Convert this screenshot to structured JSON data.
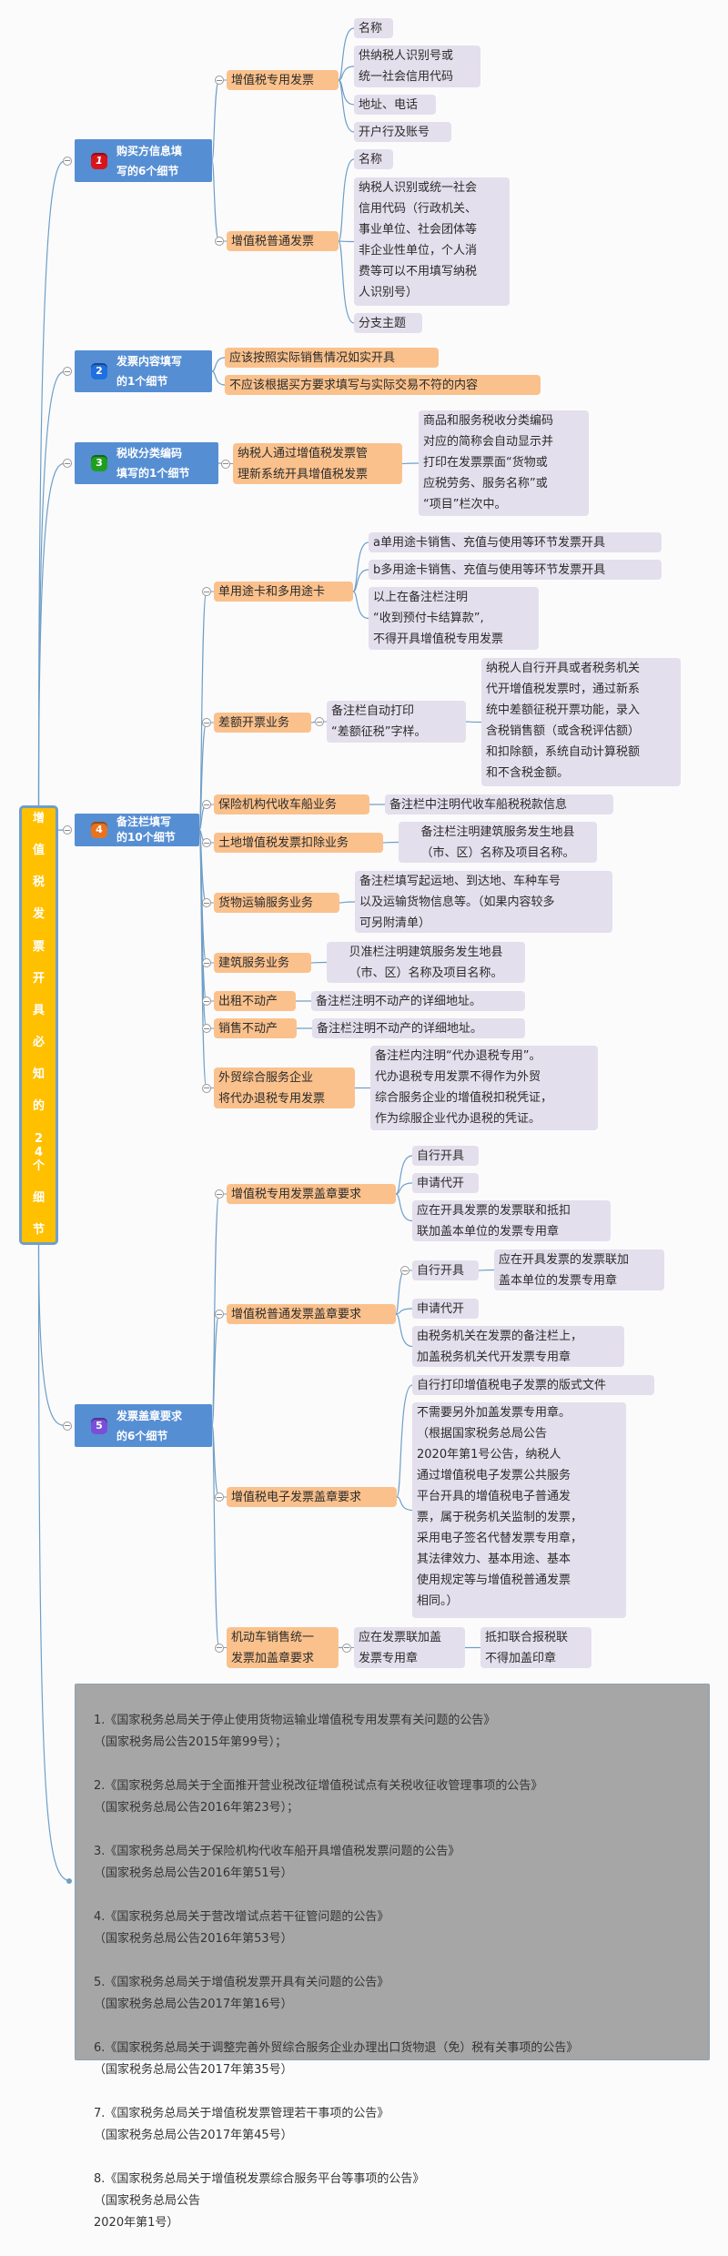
{
  "root": {
    "label": "增值税发票开具必知的24个细节",
    "chars": [
      "增",
      "值",
      "税",
      "发",
      "票",
      "开",
      "具",
      "必",
      "知",
      "的",
      "24个",
      "细",
      "节"
    ]
  },
  "colors": {
    "root": "#ffc000",
    "category": "#568ed3",
    "branch": "#fbc18c",
    "leaf": "#e4dfec",
    "line": "#6f9fc7",
    "refs": "#a6a6a6"
  },
  "categories": [
    {
      "num": "1",
      "badge_color": "#d9141a",
      "label": "购买方信息填\n写的6个细节"
    },
    {
      "num": "2",
      "badge_color": "#1f6fe0",
      "label": "发票内容填写\n的1个细节"
    },
    {
      "num": "3",
      "badge_color": "#1f9e1f",
      "label": "税收分类编码\n填写的1个细节"
    },
    {
      "num": "4",
      "badge_color": "#e8731f",
      "label": "备注栏填写\n的10个细节"
    },
    {
      "num": "5",
      "badge_color": "#7a4fd8",
      "label": "发票盖章要求\n的6个细节"
    }
  ],
  "c1": {
    "special": {
      "label": "增值税专用发票",
      "items": [
        "名称",
        "供纳税人识别号或\n统一社会信用代码",
        "地址、电话",
        "开户行及账号"
      ]
    },
    "normal": {
      "label": "增值税普通发票",
      "items": [
        "名称",
        "纳税人识别或统一社会\n信用代码（行政机关、\n事业单位、社会团体等\n非企业性单位，个人消\n费等可以不用填写纳税\n人识别号）",
        "分支主题"
      ]
    }
  },
  "c2": {
    "items": [
      "应该按照实际销售情况如实开具",
      "不应该根据买方要求填写与实际交易不符的内容"
    ]
  },
  "c3": {
    "label": "纳税人通过增值税发票管\n理新系统开具增值税发票",
    "detail": "商品和服务税收分类编码\n对应的简称会自动显示并\n打印在发票票面“货物或\n应税劳务、服务名称”或\n“项目”栏次中。"
  },
  "c4": {
    "card": {
      "label": "单用途卡和多用途卡",
      "items": [
        "a单用途卡销售、充值与使用等环节发票开具",
        "b多用途卡销售、充值与使用等环节发票开具",
        "以上在备注栏注明\n“收到预付卡结算款”,\n不得开具增值税专用发票"
      ]
    },
    "diff": {
      "label": "差额开票业务",
      "note": "备注栏自动打印\n“差额征税”字样。",
      "detail": "纳税人自行开具或者税务机关\n代开增值税发票时，通过新系\n统中差额征税开票功能，录入\n含税销售额（或含税评估额）\n和扣除额，系统自动计算税额\n和不含税金额。"
    },
    "insurance": {
      "label": "保险机构代收车船业务",
      "note": "备注栏中注明代收车船税税款信息"
    },
    "land": {
      "label": "土地增值税发票扣除业务",
      "note": "备注栏注明建筑服务发生地县\n（市、区）名称及项目名称。"
    },
    "freight": {
      "label": "货物运输服务业务",
      "note": "备注栏填写起运地、到达地、车种车号\n以及运输货物信息等。（如果内容较多\n可另附清单）"
    },
    "construction": {
      "label": "建筑服务业务",
      "note": "贝准栏注明建筑服务发生地县\n（市、区）名称及项目名称。"
    },
    "rent": {
      "label": "出租不动产",
      "note": "备注栏注明不动产的详细地址。"
    },
    "sale": {
      "label": "销售不动产",
      "note": "备注栏注明不动产的详细地址。"
    },
    "trade": {
      "label": "外贸综合服务企业\n将代办退税专用发票",
      "note": "备注栏内注明“代办退税专用”。\n代办退税专用发票不得作为外贸\n综合服务企业的增值税扣税凭证，\n作为综服企业代办退税的凭证。"
    }
  },
  "c5": {
    "special": {
      "label": "增值税专用发票盖章要求",
      "items": [
        "自行开具",
        "申请代开",
        "应在开具发票的发票联和抵扣\n联加盖本单位的发票专用章"
      ]
    },
    "normal": {
      "label": "增值税普通发票盖章要求",
      "self": "自行开具",
      "self_note": "应在开具发票的发票联加\n盖本单位的发票专用章",
      "apply": "申请代开",
      "apply_note": "由税务机关在发票的备注栏上，\n加盖税务机关代开发票专用章"
    },
    "electronic": {
      "label": "增值税电子发票盖章要求",
      "items": [
        "自行打印增值税电子发票的版式文件",
        "不需要另外加盖发票专用章。\n（根据国家税务总局公告\n2020年第1号公告，纳税人\n通过增值税电子发票公共服务\n平台开具的增值税电子普通发\n票，属于税务机关监制的发票，\n采用电子签名代替发票专用章，\n其法律效力、基本用途、基本\n使用规定等与增值税普通发票\n相同。）"
      ]
    },
    "motor": {
      "label": "机动车销售统一\n发票加盖章要求",
      "note": "应在发票联加盖\n发票专用章",
      "detail": "抵扣联合报税联\n不得加盖印章"
    }
  },
  "references": [
    "1.《国家税务总局关于停止使用货物运输业增值税专用发票有关问题的公告》\n（国家税务局公告2015年第99号）；",
    "2.《国家税务总局关于全面推开营业税改征增值税试点有关税收征收管理事项的公告》\n（国家税务总局公告2016年第23号）；",
    "3.《国家税务总局关于保险机构代收车船开具增值税发票问题的公告》\n（国家税务总局公告2016年第51号）",
    "4.《国家税务总局关于营改增试点若干征管问题的公告》\n（国家税务总局公告2016年第53号）",
    "5.《国家税务总局关于增值税发票开具有关问题的公告》\n（国家税务总局公告2017年第16号）",
    "6.《国家税务总局关于调整完善外贸综合服务企业办理出口货物退（免）税有关事项的公告》\n（国家税务总局公告2017年第35号）",
    "7.《国家税务总局关于增值税发票管理若干事项的公告》\n（国家税务总局公告2017年第45号）",
    "8.《国家税务总局关于增值税发票综合服务平台等事项的公告》\n（国家税务总局公告\n2020年第1号）"
  ]
}
